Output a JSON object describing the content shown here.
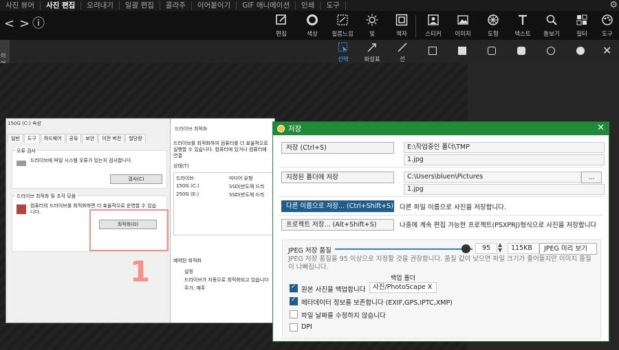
{
  "menubar": {
    "items": [
      "사진 뷰어",
      "사진 편집",
      "오려내기",
      "일괄 편집",
      "콜라주",
      "이어붙이기",
      "GIF 애니메이션",
      "인쇄",
      "도구"
    ],
    "active_index": 1
  },
  "toolbar": {
    "nav": {
      "back": "<",
      "forward": ">",
      "info": "ⓘ"
    },
    "tools": [
      {
        "label": "편집",
        "icon": "edit-icon"
      },
      {
        "label": "색상",
        "icon": "color-icon"
      },
      {
        "label": "필름느낌",
        "icon": "film-icon"
      },
      {
        "label": "빛",
        "icon": "light-icon"
      },
      {
        "label": "액자",
        "icon": "frame-icon"
      },
      {
        "label": "스티커",
        "icon": "sticker-icon"
      },
      {
        "label": "이미지",
        "icon": "image-icon"
      },
      {
        "label": "도형",
        "icon": "shape-icon"
      },
      {
        "label": "텍스트",
        "icon": "text-icon"
      },
      {
        "label": "돋보기",
        "icon": "magnifier-icon"
      },
      {
        "label": "필터",
        "icon": "filter-icon"
      },
      {
        "label": "도구",
        "icon": "tools-icon"
      }
    ],
    "side_label": "이어"
  },
  "toolbar2": {
    "tools": [
      {
        "label": "선택",
        "icon": "select-icon"
      },
      {
        "label": "화살표",
        "icon": "arrow-icon"
      },
      {
        "label": "선",
        "icon": "line-icon"
      }
    ],
    "shapes": [
      "square-outline-icon",
      "square-filled-icon",
      "rounded-outline-icon",
      "rounded-filled-icon",
      "circle-outline-icon",
      "circle-filled-icon"
    ],
    "close": "✕"
  },
  "screenshot": {
    "win1": {
      "title": "150G (C:) 속성",
      "tabs": [
        "일반",
        "도구",
        "하드웨어",
        "공유",
        "보안",
        "이전 버전",
        "할당량"
      ],
      "check_group": "오류 검사",
      "check_text": "드라이브에 파일 시스템 오류가 있는지 검사합니다.",
      "check_button": "검사(C)",
      "optimize_group": "드라이브 최적화 및 조각 모음",
      "optimize_text": "컴퓨터의 드라이브를 최적화하면 더 효율적으로 운영할 수 있습니다.",
      "optimize_button": "최적화(O)",
      "marker": "1"
    },
    "win2": {
      "title": "드라이브 최적화",
      "text": "드라이브를 최적화하여 컴퓨터를 더 효율적으로 실행할 수 있습니다. 컴퓨터에 있거나 컴퓨터에 연결",
      "status": "상태(T)",
      "col_drive": "드라이브",
      "col_media": "미디어 유형",
      "drives": [
        {
          "name": "150G (C:)",
          "media": "SSD(반도체 드라"
        },
        {
          "name": "250G (E:)",
          "media": "SSD(반도체 드라"
        }
      ],
      "scheduled": "예약된 최적화",
      "setting": "설정",
      "auto_text": "드라이브가 자동으로 최적화되고 있습니다",
      "period": "주기: 매주"
    }
  },
  "dialog": {
    "title": "저장",
    "save_button": "저장  (Ctrl+S)",
    "save_path": "E:\\작업중인 폴더\\TMP",
    "save_file": "1.jpg",
    "folder_button": "지정된 폴더에 저장",
    "folder_path": "C:\\Users\\bluen\\Pictures",
    "browse": "...",
    "folder_file": "1.jpg",
    "saveas_button": "다른 이름으로 저장...   (Ctrl+Shift+S)",
    "saveas_desc": "다른 파일 이름으로 사진을 저장합니다.",
    "project_button": "프로젝트 저장...   (Alt+Shift+S)",
    "project_desc": "나중에 계속 편집 가능한 프로젝트(PSXPRJ)형식으로 사진을 저장합니다",
    "jpeg": {
      "quality_label": "JPEG 저장 품질",
      "quality_value": "95",
      "quality_fraction": 0.95,
      "size": "115KB",
      "preview_button": "JPEG 미리 보기",
      "note": "JPEG 저장 품질을 95 이상으로 지정할 것을 권장합니다. 품질 값이 낮으면 파일 크기가 줄어들지만 이미지 품질이 나빠집니다.",
      "backup_folder_label": "백업 폴더",
      "backup_label": "원본 사진을 백업합니다",
      "backup_folder": "사진/PhotoScape X",
      "metadata_label": "메타데이터 정보를 보존합니다 (EXIF,GPS,IPTC,XMP)",
      "keep_date_label": "파일 날짜를 수정하지 않습니다",
      "dpi_label": "DPI",
      "backup_checked": true,
      "metadata_checked": true,
      "keep_date_checked": false,
      "dpi_checked": false
    }
  },
  "colors": {
    "dialog_title": "#1f8b38",
    "selected_button": "#1e5d8d",
    "annotation": "#f3928a"
  }
}
